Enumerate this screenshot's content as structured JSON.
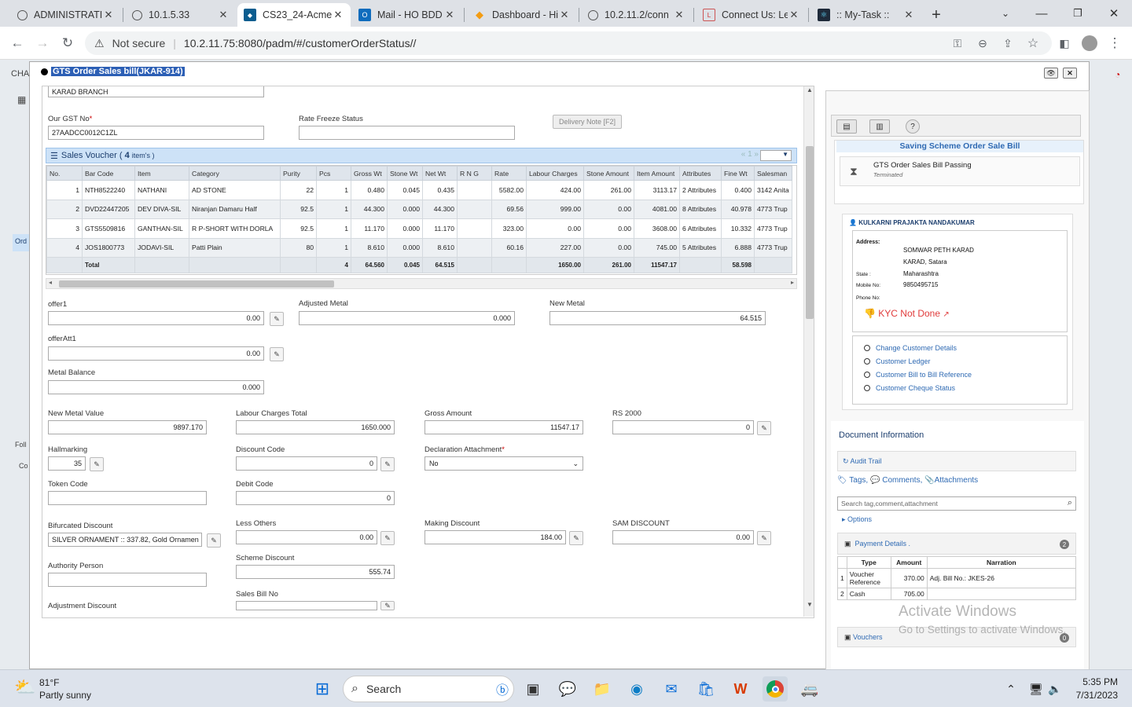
{
  "browser": {
    "tabs": [
      {
        "label": "ADMINISTRATI",
        "icon": "globe-icon"
      },
      {
        "label": "10.1.5.33",
        "icon": "globe-icon"
      },
      {
        "label": "CS23_24-Acme",
        "icon": "app-icon"
      },
      {
        "label": "Mail - HO BDD",
        "icon": "outlook-icon"
      },
      {
        "label": "Dashboard - Hi",
        "icon": "diamond-icon"
      },
      {
        "label": "10.2.11.2/conn",
        "icon": "globe-icon"
      },
      {
        "label": "Connect Us: Le",
        "icon": "logo-icon"
      },
      {
        "label": ":: My-Task ::",
        "icon": "react-icon"
      }
    ],
    "security": "Not secure",
    "url": "10.2.11.75:8080/padm/#/customerOrderStatus//"
  },
  "background": {
    "cha": "CHA",
    "ord": "Ord",
    "foll": "Foll",
    "co": "Co"
  },
  "modal": {
    "title": "GTS Order Sales bill(JKAR-914)",
    "branch": "KARAD BRANCH",
    "gst_label": "Our GST No",
    "gst_value": "27AADCC0012C1ZL",
    "rate_freeze_label": "Rate Freeze Status",
    "delivery_btn": "Delivery Note [F2]",
    "voucher": {
      "title": "Sales Voucher (",
      "count": "4",
      "items": "item's )",
      "pager": "« 1 »",
      "columns": [
        "No.",
        "Bar Code",
        "Item",
        "Category",
        "Purity",
        "Pcs",
        "Gross Wt",
        "Stone Wt",
        "Net Wt",
        "R N G",
        "Rate",
        "Labour Charges",
        "Stone Amount",
        "Item Amount",
        "Attributes",
        "Fine Wt",
        "Salesman"
      ],
      "rows": [
        [
          "1",
          "NTH8522240",
          "NATHANI",
          "AD STONE",
          "22",
          "1",
          "0.480",
          "0.045",
          "0.435",
          "",
          "5582.00",
          "424.00",
          "261.00",
          "3113.17",
          "2 Attributes",
          "0.400",
          "3142 Anita"
        ],
        [
          "2",
          "DVD22447205",
          "DEV DIVA-SIL",
          "Niranjan Damaru Half",
          "92.5",
          "1",
          "44.300",
          "0.000",
          "44.300",
          "",
          "69.56",
          "999.00",
          "0.00",
          "4081.00",
          "8 Attributes",
          "40.978",
          "4773 Trup"
        ],
        [
          "3",
          "GTS5509816",
          "GANTHAN-SIL",
          "R P-SHORT WITH DORLA",
          "92.5",
          "1",
          "11.170",
          "0.000",
          "11.170",
          "",
          "323.00",
          "0.00",
          "0.00",
          "3608.00",
          "6 Attributes",
          "10.332",
          "4773 Trup"
        ],
        [
          "4",
          "JOS1800773",
          "JODAVI-SIL",
          "Patti Plain",
          "80",
          "1",
          "8.610",
          "0.000",
          "8.610",
          "",
          "60.16",
          "227.00",
          "0.00",
          "745.00",
          "5 Attributes",
          "6.888",
          "4773 Trup"
        ]
      ],
      "total": [
        "",
        "Total",
        "",
        "",
        "",
        "4",
        "64.560",
        "0.045",
        "64.515",
        "",
        "",
        "1650.00",
        "261.00",
        "11547.17",
        "",
        "58.598",
        ""
      ]
    },
    "fields": {
      "offer1": {
        "label": "offer1",
        "value": "0.00"
      },
      "adjusted_metal": {
        "label": "Adjusted Metal",
        "value": "0.000"
      },
      "new_metal": {
        "label": "New Metal",
        "value": "64.515"
      },
      "offeratt1": {
        "label": "offerAtt1",
        "value": "0.00"
      },
      "metal_balance": {
        "label": "Metal Balance",
        "value": "0.000"
      },
      "new_metal_value": {
        "label": "New Metal Value",
        "value": "9897.170"
      },
      "labour_total": {
        "label": "Labour Charges Total",
        "value": "1650.000"
      },
      "gross_amount": {
        "label": "Gross Amount",
        "value": "11547.17"
      },
      "rs2000": {
        "label": "RS 2000",
        "value": "0"
      },
      "hallmarking": {
        "label": "Hallmarking",
        "value": "35"
      },
      "discount_code": {
        "label": "Discount Code",
        "value": "0"
      },
      "declaration": {
        "label": "Declaration Attachment",
        "value": "No"
      },
      "token_code": {
        "label": "Token Code",
        "value": ""
      },
      "debit_code": {
        "label": "Debit Code",
        "value": "0"
      },
      "bifurcated": {
        "label": "Bifurcated Discount",
        "value": "SILVER ORNAMENT :: 337.82, Gold Ornamen"
      },
      "less_others": {
        "label": "Less Others",
        "value": "0.00"
      },
      "making_discount": {
        "label": "Making Discount",
        "value": "184.00"
      },
      "sam_discount": {
        "label": "SAM DISCOUNT",
        "value": "0.00"
      },
      "authority": {
        "label": "Authority Person",
        "value": ""
      },
      "scheme_discount": {
        "label": "Scheme Discount",
        "value": "555.74"
      },
      "sales_bill_no": {
        "label": "Sales Bill No",
        "value": ""
      },
      "adjustment_discount": {
        "label": "Adjustment Discount",
        "value": ""
      }
    }
  },
  "side": {
    "scheme_title": "Saving Scheme Order Sale Bill",
    "status_title": "GTS Order Sales Bill Passing",
    "status_sub": "Terminated",
    "customer_name": "KULKARNI PRAJAKTA NANDAKUMAR",
    "address_label": "Address:",
    "address1": "SOMWAR PETH KARAD",
    "address2": "KARAD, Satara",
    "state_label": "State :",
    "state": "Maharashtra",
    "mobile_label": "Mobile No:",
    "mobile": "9850495715",
    "phone_label": "Phone No:",
    "kyc": "KYC Not Done",
    "links": [
      "Change Customer Details",
      "Customer Ledger",
      "Customer Bill to Bill Reference",
      "Customer Cheque Status"
    ],
    "doc_title": "Document Information",
    "audit": "Audit Trail",
    "tags": "Tags,",
    "comments": "Comments,",
    "attachments": "Attachments",
    "search_placeholder": "Search tag,comment,attachment",
    "options": "Options",
    "payment_title": "Payment Details .",
    "payment_count": "2",
    "payment_cols": [
      "Type",
      "Amount",
      "Narration"
    ],
    "payment_rows": [
      [
        "1",
        "Voucher Reference",
        "370.00",
        "Adj. Bill No.: JKES-26"
      ],
      [
        "2",
        "Cash",
        "705.00",
        ""
      ]
    ],
    "vouchers": "Vouchers",
    "vouchers_count": "0"
  },
  "watermark": {
    "line1": "Activate Windows",
    "line2": "Go to Settings to activate Windows."
  },
  "taskbar": {
    "temp": "81°F",
    "weather": "Partly sunny",
    "search": "Search",
    "time": "5:35 PM",
    "date": "7/31/2023"
  }
}
